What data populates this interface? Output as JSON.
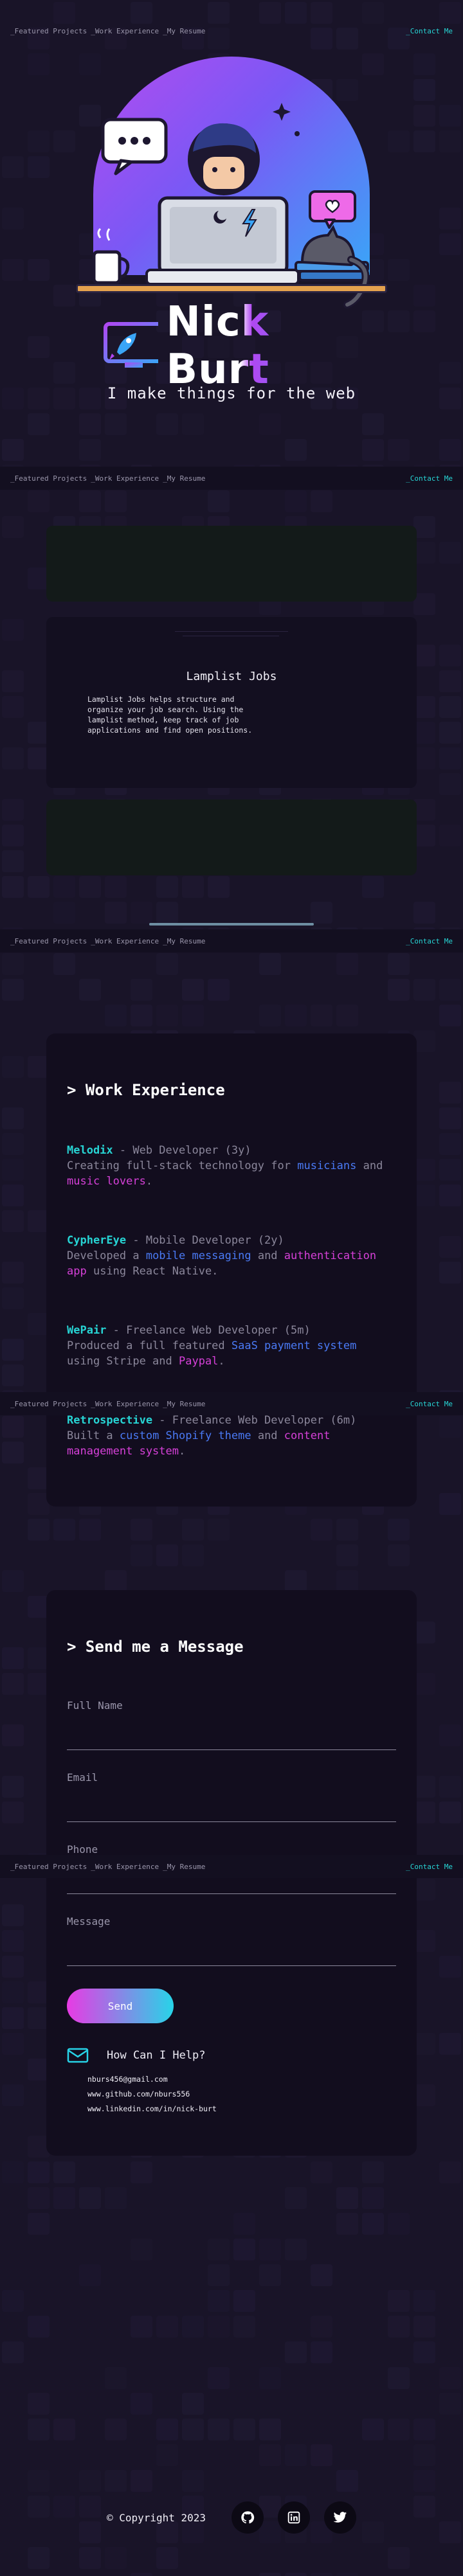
{
  "nav": {
    "links": [
      "_Featured Projects",
      "_Work Experience",
      "_My Resume"
    ],
    "contact": "_Contact Me"
  },
  "hero": {
    "brand": "Nick Burt",
    "tagline": "I make things for the web",
    "colors": {
      "gradient_start": "#b34cf0",
      "gradient_end": "#3aa5f7",
      "accent": "#27d4d4"
    }
  },
  "projects": {
    "current": {
      "title": "Lamplist Jobs",
      "description": "Lamplist Jobs helps structure and organize your job search. Using the lamplist method, keep track of job applications and find open positions."
    }
  },
  "experience": {
    "heading": "> Work Experience",
    "jobs": [
      {
        "company": "Melodix",
        "role": " - Web Developer (3y)",
        "desc": [
          {
            "t": "Creating full-stack technology for ",
            "c": ""
          },
          {
            "t": "musicians",
            "c": "blue"
          },
          {
            "t": " and ",
            "c": ""
          },
          {
            "t": "music lovers",
            "c": "pink"
          },
          {
            "t": ".",
            "c": ""
          }
        ]
      },
      {
        "company": "CypherEye",
        "role": " - Mobile Developer (2y)",
        "desc": [
          {
            "t": "Developed a ",
            "c": ""
          },
          {
            "t": "mobile messaging",
            "c": "blue"
          },
          {
            "t": " and ",
            "c": ""
          },
          {
            "t": "authentication app",
            "c": "pink"
          },
          {
            "t": " using React Native.",
            "c": ""
          }
        ]
      },
      {
        "company": "WePair",
        "role": " - Freelance Web Developer (5m)",
        "desc": [
          {
            "t": "Produced a full featured ",
            "c": ""
          },
          {
            "t": "SaaS payment system",
            "c": "blue"
          },
          {
            "t": " using Stripe and ",
            "c": ""
          },
          {
            "t": "Paypal",
            "c": "pink"
          },
          {
            "t": ".",
            "c": ""
          }
        ]
      },
      {
        "company": "Retrospective",
        "role": " - Freelance Web Developer (6m)",
        "desc": [
          {
            "t": "Built a ",
            "c": ""
          },
          {
            "t": "custom Shopify theme",
            "c": "blue"
          },
          {
            "t": " and ",
            "c": ""
          },
          {
            "t": "content management system",
            "c": "pink"
          },
          {
            "t": ".",
            "c": ""
          }
        ]
      }
    ]
  },
  "contact": {
    "heading": "> Send me a Message",
    "fields": {
      "name": "Full Name",
      "email": "Email",
      "phone": "Phone",
      "message": "Message"
    },
    "send": "Send",
    "help_title": "How Can I Help?",
    "email": "nburs456@gmail.com",
    "github": "www.github.com/nburs556",
    "linkedin": "www.linkedin.com/in/nick-burt"
  },
  "footer": {
    "copyright": "© Copyright 2023",
    "social_icons": [
      "github-icon",
      "linkedin-icon",
      "twitter-icon"
    ]
  }
}
